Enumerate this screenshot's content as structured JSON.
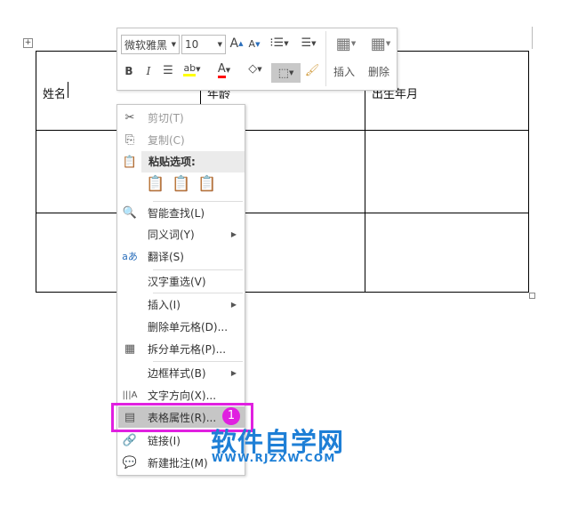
{
  "table": {
    "headers": [
      "姓名",
      "年龄",
      "出生年月"
    ]
  },
  "toolbar": {
    "font": "微软雅黑",
    "size": "10",
    "insert": "插入",
    "delete": "删除",
    "bold": "B",
    "italic": "I"
  },
  "menu": {
    "cut": "剪切(T)",
    "copy": "复制(C)",
    "paste_options": "粘贴选项:",
    "smart_lookup": "智能查找(L)",
    "synonyms": "同义词(Y)",
    "translate": "翻译(S)",
    "reconvert": "汉字重选(V)",
    "insert": "插入(I)",
    "delete_cells": "删除单元格(D)...",
    "split_cells": "拆分单元格(P)...",
    "border_styles": "边框样式(B)",
    "text_direction": "文字方向(X)...",
    "table_properties": "表格属性(R)...",
    "link": "链接(I)",
    "new_comment": "新建批注(M)"
  },
  "badge": "1",
  "watermark": {
    "title": "软件自学网",
    "url": "WWW.RJZXW.COM"
  },
  "colors": {
    "highlight": "#e020e0",
    "accent": "#1e7fd6"
  }
}
